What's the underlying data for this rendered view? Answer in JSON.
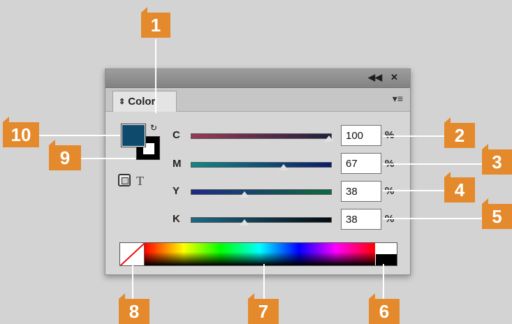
{
  "panel": {
    "collapse_icon": "double-chevron-left-icon",
    "close_icon": "close-icon",
    "tab_label": "Color",
    "menu_icon": "panel-menu-icon"
  },
  "channels": [
    {
      "label": "C",
      "value": "100",
      "unit": "%",
      "level": 1.0
    },
    {
      "label": "M",
      "value": "67",
      "unit": "%",
      "level": 0.67
    },
    {
      "label": "Y",
      "value": "38",
      "unit": "%",
      "level": 0.38
    },
    {
      "label": "K",
      "value": "38",
      "unit": "%",
      "level": 0.38
    }
  ],
  "swatch": {
    "fill_color": "#0e4a6c",
    "stroke_color": "#000000"
  },
  "callouts": [
    "1",
    "2",
    "3",
    "4",
    "5",
    "6",
    "7",
    "8",
    "9",
    "10"
  ],
  "colors": {
    "callout": "#e48a2d"
  }
}
